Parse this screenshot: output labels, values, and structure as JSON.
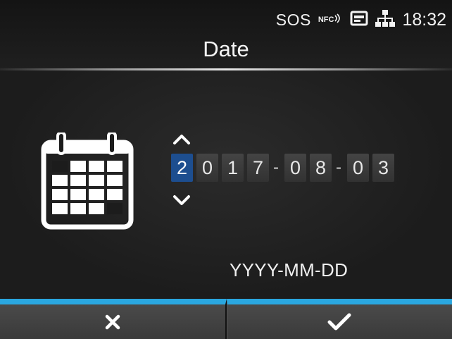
{
  "status_bar": {
    "sos_label": "SOS",
    "nfc_label": "NFC",
    "time": "18:32",
    "icons": [
      "nfc-icon",
      "card-reader-icon",
      "network-icon"
    ]
  },
  "header": {
    "title": "Date"
  },
  "date_editor": {
    "year_digits": [
      "2",
      "0",
      "1",
      "7"
    ],
    "month_digits": [
      "0",
      "8"
    ],
    "day_digits": [
      "0",
      "3"
    ],
    "separator": "-",
    "selected_position": "year-digit-1",
    "format_label": "YYYY-MM-DD"
  },
  "footer": {
    "cancel_icon": "close-icon",
    "confirm_icon": "checkmark-icon"
  },
  "colors": {
    "accent": "#2aa7e0",
    "selected_digit": "#1d4e8f",
    "background": "#1c1c1c"
  }
}
